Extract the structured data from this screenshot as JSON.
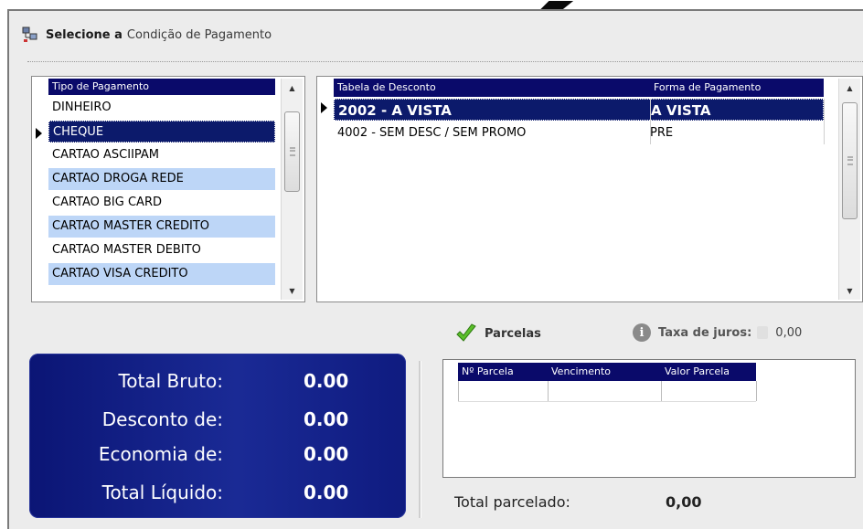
{
  "header": {
    "title_bold": "Selecione a",
    "title_rest": "Condição de Pagamento",
    "icon": "payment-settings-icon"
  },
  "payment_types": {
    "column": "Tipo de Pagamento",
    "items": [
      "DINHEIRO",
      "CHEQUE",
      "CARTAO ASCIIPAM",
      "CARTAO DROGA REDE",
      "CARTAO BIG CARD",
      "CARTAO MASTER CREDITO",
      "CARTAO MASTER DEBITO",
      "CARTAO VISA CREDITO"
    ],
    "selected": "CHEQUE"
  },
  "discount_table": {
    "columns": [
      "Tabela de Desconto",
      "Forma de Pagamento"
    ],
    "rows": [
      [
        "2002 - A VISTA",
        "A VISTA"
      ],
      [
        "4002 - SEM DESC / SEM PROMO",
        "PRE"
      ]
    ],
    "selected": "2002 - A VISTA"
  },
  "parcelas": {
    "label": "Parcelas",
    "taxa_label": "Taxa de juros:",
    "taxa_value": "0,00",
    "columns": [
      "Nº Parcela",
      "Vencimento",
      "Valor Parcela"
    ]
  },
  "totals": {
    "rows": [
      {
        "label": "Total Bruto:",
        "value": "0.00"
      },
      {
        "label": "Desconto de:",
        "value": "0.00"
      },
      {
        "label": "Economia de:",
        "value": "0.00"
      },
      {
        "label": "Total Líquido:",
        "value": "0.00"
      }
    ]
  },
  "total_parcelado": {
    "label": "Total parcelado:",
    "value": "0,00"
  },
  "colors": {
    "selection": "#0c1a6b",
    "header": "#0a0a6a",
    "alternate_row": "#bdd6f7",
    "totals_panel": "#1a2a95"
  }
}
